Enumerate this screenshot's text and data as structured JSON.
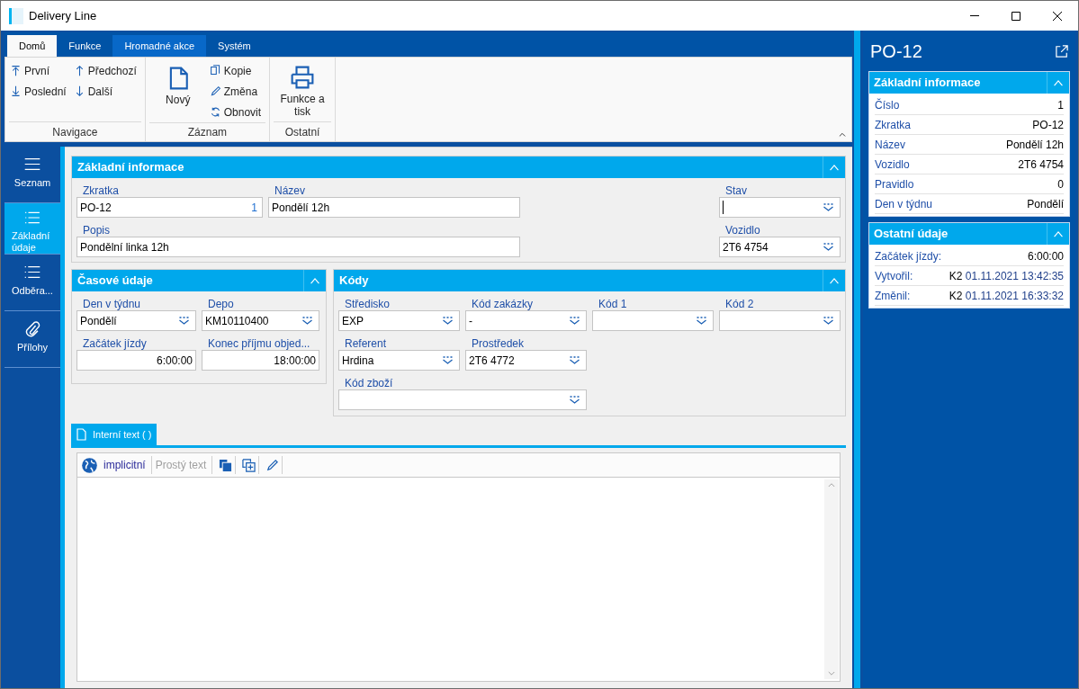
{
  "window": {
    "title": "Delivery Line"
  },
  "ribbon": {
    "tabs": [
      {
        "label": "Domů",
        "selected": true,
        "highlighted": false
      },
      {
        "label": "Funkce",
        "selected": false,
        "highlighted": false
      },
      {
        "label": "Hromadné akce",
        "selected": false,
        "highlighted": true
      },
      {
        "label": "Systém",
        "selected": false,
        "highlighted": false
      }
    ],
    "groups": [
      {
        "label": "Navigace",
        "columns": [
          [
            {
              "label": "První"
            },
            {
              "label": "Poslední"
            }
          ],
          [
            {
              "label": "Předchozí"
            },
            {
              "label": "Další"
            }
          ]
        ]
      },
      {
        "label": "Záznam",
        "columns": [
          [
            {
              "label": "Nový"
            }
          ],
          [
            {
              "label": "Kopie"
            },
            {
              "label": "Změna"
            },
            {
              "label": "Obnovit"
            }
          ]
        ]
      },
      {
        "label": "Ostatní",
        "columns": [
          [
            {
              "label": "Funkce a tisk"
            }
          ]
        ]
      }
    ]
  },
  "nav": [
    {
      "label": "Seznam",
      "selected": false
    },
    {
      "label": "Základní údaje",
      "selected": true
    },
    {
      "label": "Odběra...",
      "selected": false
    },
    {
      "label": "Přílohy",
      "selected": false
    }
  ],
  "basic_info": {
    "title": "Základní informace",
    "fields": [
      {
        "label": "Zkratka",
        "kind": "text",
        "value": "PO-12",
        "suffix": "1",
        "focused": false
      },
      {
        "label": "Název",
        "kind": "text",
        "value": "Pondělí 12h",
        "focused": false
      },
      {
        "label": "Stav",
        "kind": "combo",
        "focused": true
      },
      {
        "label": "Popis",
        "kind": "text",
        "value": "Pondělní linka 12h",
        "focused": false
      },
      {
        "label": "Vozidlo",
        "kind": "combo",
        "value": "2T6 4754",
        "focused": false
      }
    ]
  },
  "time_info": {
    "title": "Časové údaje",
    "fields": [
      {
        "label": "Den v týdnu",
        "kind": "combo",
        "value": "Pondělí"
      },
      {
        "label": "Depo",
        "kind": "combo",
        "value": "KM10110400"
      },
      {
        "label": "Začátek jízdy",
        "kind": "time",
        "value": "6:00:00"
      },
      {
        "label": "Konec příjmu objed...",
        "kind": "time",
        "value": "18:00:00"
      }
    ]
  },
  "codes": {
    "title": "Kódy",
    "fields": [
      {
        "label": "Středisko",
        "kind": "combo",
        "value": "EXP"
      },
      {
        "label": "Kód zakázky",
        "kind": "combo",
        "value": "-"
      },
      {
        "label": "Kód 1",
        "kind": "combo"
      },
      {
        "label": "Kód 2",
        "kind": "combo"
      },
      {
        "label": "Referent",
        "kind": "combo",
        "value": "Hrdina"
      },
      {
        "label": "Prostředek",
        "kind": "combo",
        "value": "2T6 4772"
      },
      {
        "label": "Kód zboží",
        "kind": "combo"
      }
    ]
  },
  "editor": {
    "tab": "Interní text ( )",
    "language": "implicitní",
    "format": {
      "label": "Prostý text",
      "disabled": true
    }
  },
  "side_panel": {
    "title": "PO-12",
    "sections": [
      {
        "title": "Základní informace",
        "rows": [
          {
            "label": "Číslo",
            "value": "1"
          },
          {
            "label": "Zkratka",
            "value": "PO-12"
          },
          {
            "label": "Název",
            "value": "Pondělí 12h"
          },
          {
            "label": "Vozidlo",
            "value": "2T6 4754"
          },
          {
            "label": "Pravidlo",
            "value": "0"
          },
          {
            "label": "Den v týdnu",
            "value": "Pondělí"
          }
        ]
      },
      {
        "title": "Ostatní údaje",
        "rows": [
          {
            "label": "Začátek jízdy:",
            "value": "6:00:00"
          },
          {
            "label": "Vytvořil:",
            "user": "K2",
            "value": "01.11.2021 13:42:35"
          },
          {
            "label": "Změnil:",
            "user": "K2",
            "value": "01.11.2021 16:33:32"
          }
        ]
      }
    ]
  }
}
